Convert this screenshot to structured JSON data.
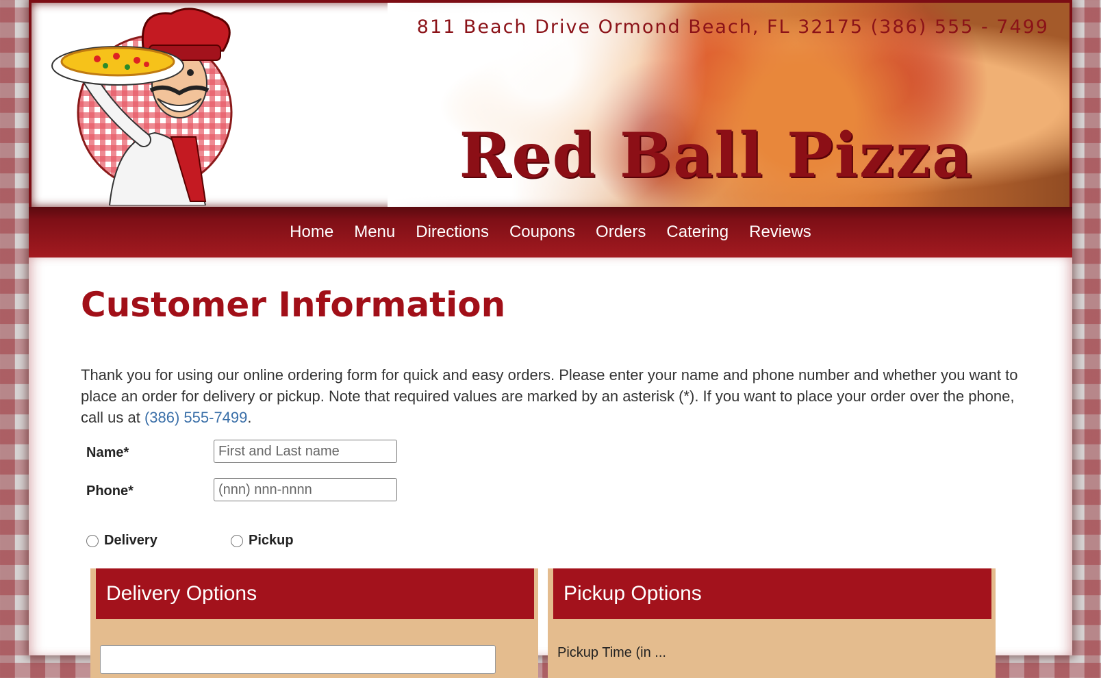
{
  "header": {
    "address": "811 Beach Drive  Ormond Beach, FL  32175   (386) 555 - 7499",
    "brand": "Red Ball Pizza"
  },
  "nav": {
    "items": [
      "Home",
      "Menu",
      "Directions",
      "Coupons",
      "Orders",
      "Catering",
      "Reviews"
    ]
  },
  "main": {
    "title": "Customer Information",
    "intro_text": "Thank you for using our online ordering form for quick and easy orders. Please enter your name and phone number and whether you want to place an order for delivery or pickup. Note that required values are marked by an asterisk (*). If you want to place your order over the phone, call us at ",
    "intro_phone": "(386) 555-7499",
    "intro_end": "."
  },
  "form": {
    "name_label": "Name*",
    "name_placeholder": "First and Last name",
    "phone_label": "Phone*",
    "phone_placeholder": "(nnn) nnn-nnnn",
    "delivery_label": "Delivery",
    "pickup_label": "Pickup"
  },
  "panels": {
    "delivery_title": "Delivery Options",
    "pickup_title": "Pickup Options",
    "pickup_hint": "Pickup Time (in ..."
  },
  "colors": {
    "brand_red": "#a3121c",
    "link_blue": "#3a6fa8",
    "panel_tan": "#e4bc8e"
  }
}
